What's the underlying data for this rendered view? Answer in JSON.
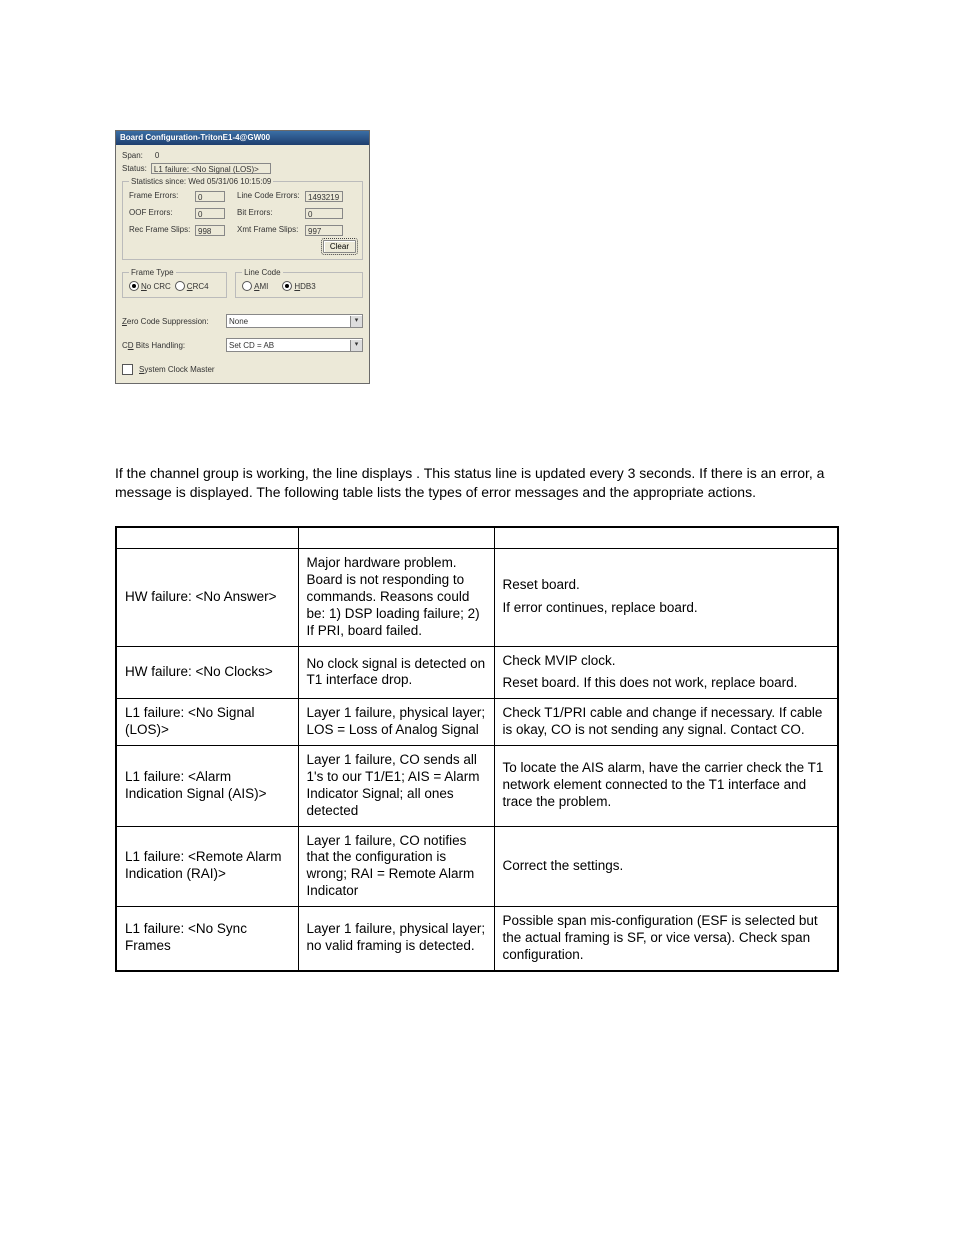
{
  "dialog": {
    "title": "Board Configuration-TritonE1-4@GW00",
    "span_label": "Span:",
    "span_value": "0",
    "status_label": "Status:",
    "status_value": "L1 failure: <No Signal (LOS)>",
    "stats_legend": "Statistics since: Wed 05/31/06 10:15:09",
    "stats": {
      "frame_errors_label": "Frame Errors:",
      "frame_errors_value": "0",
      "line_code_errors_label": "Line Code Errors:",
      "line_code_errors_value": "1493219",
      "oof_errors_label": "OOF Errors:",
      "oof_errors_value": "0",
      "bit_errors_label": "Bit Errors:",
      "bit_errors_value": "0",
      "rec_slips_label": "Rec Frame Slips:",
      "rec_slips_value": "998",
      "xmt_slips_label": "Xmt Frame Slips:",
      "xmt_slips_value": "997"
    },
    "clear_button": "Clear",
    "frame_type_legend": "Frame Type",
    "frame_type_opts": {
      "nocrc": "No CRC",
      "crc4": "CRC4"
    },
    "line_code_legend": "Line Code",
    "line_code_opts": {
      "ami": "AMI",
      "hdb3": "HDB3"
    },
    "zero_suppression_label": "Zero Code Suppression:",
    "zero_suppression_value": "None",
    "cd_bits_label": "CD Bits Handling:",
    "cd_bits_value": "Set CD = AB",
    "system_clock_label": "System Clock Master"
  },
  "paragraph": "If the channel group is working, the          line displays     . This status line is updated every 3 seconds. If there is an error, a message is displayed. The following table lists the types of error messages and the appropriate actions.",
  "table_rows": [
    {
      "msg": "HW failure: <No Answer>",
      "desc": "Major hardware problem. Board is not responding to commands. Reasons could be: 1) DSP loading failure; 2) If PRI, board failed.",
      "act": [
        "Reset board.",
        "If error continues, replace board."
      ]
    },
    {
      "msg": "HW failure: <No Clocks>",
      "desc": "No clock signal is detected on T1 interface drop.",
      "act": [
        "Check MVIP clock.",
        "Reset board. If this does not work, replace board."
      ]
    },
    {
      "msg": "L1 failure: <No Signal (LOS)>",
      "desc": "Layer 1 failure, physical layer; LOS = Loss of Analog Signal",
      "act": [
        "Check T1/PRI cable and change if necessary. If cable is okay, CO is not sending any signal. Contact CO."
      ]
    },
    {
      "msg": "L1 failure: <Alarm Indication Signal (AIS)>",
      "desc": "Layer 1 failure, CO sends all 1's to our T1/E1; AIS = Alarm Indicator Signal; all ones detected",
      "act": [
        "To locate the AIS alarm, have the carrier check the T1 network element connected to the T1 interface and trace the problem."
      ]
    },
    {
      "msg": "L1 failure: <Remote Alarm Indication (RAI)>",
      "desc": "Layer 1 failure, CO notifies that the configuration is wrong; RAI = Remote Alarm Indicator",
      "act": [
        "Correct the settings."
      ]
    },
    {
      "msg": "L1 failure: <No Sync Frames",
      "desc": "Layer 1 failure, physical layer; no valid framing is detected.",
      "act": [
        "Possible span mis-configuration (ESF is selected but the actual framing is SF, or vice versa). Check span configuration."
      ]
    }
  ]
}
